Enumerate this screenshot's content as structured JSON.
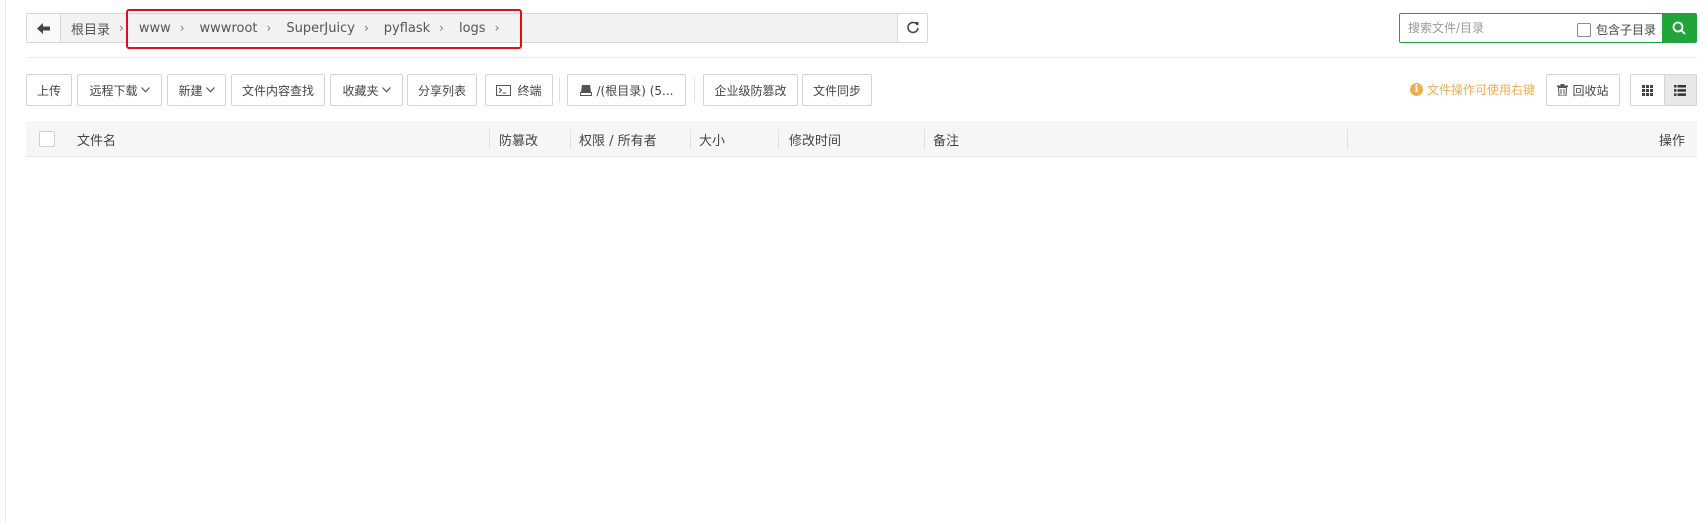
{
  "path": {
    "crumbs": [
      "根目录",
      "www",
      "wwwroot",
      "SuperJuicy",
      "pyflask",
      "logs"
    ],
    "separator": "›"
  },
  "search": {
    "placeholder": "搜索文件/目录",
    "include_subdir_label": "包含子目录"
  },
  "toolbar": {
    "upload": "上传",
    "remote_download": "远程下载",
    "new": "新建",
    "content_search": "文件内容查找",
    "favorites": "收藏夹",
    "share_list": "分享列表",
    "terminal": "终端",
    "disk": "/(根目录) (5...",
    "tamper_proof": "企业级防篡改",
    "file_sync": "文件同步",
    "tip": "文件操作可使用右键",
    "recycle_bin": "回收站"
  },
  "table": {
    "columns": [
      "文件名",
      "防篡改",
      "权限 / 所有者",
      "大小",
      "修改时间",
      "备注",
      "操作"
    ]
  },
  "colors": {
    "accent": "#20a53a",
    "highlight": "#e01010",
    "tip": "#f0ad4e"
  }
}
